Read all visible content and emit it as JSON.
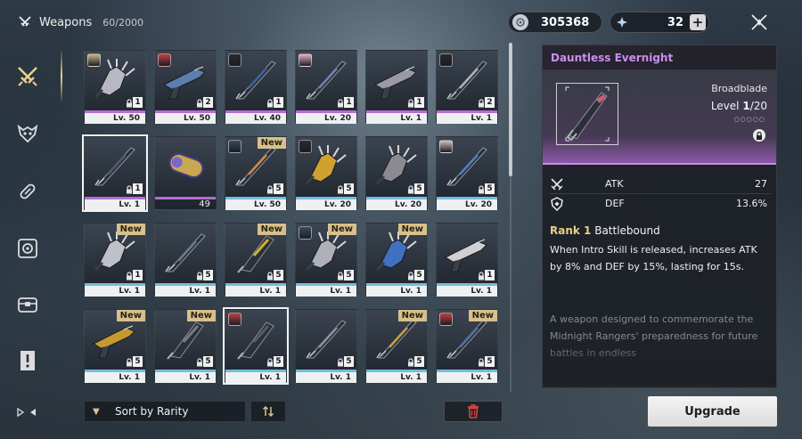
{
  "header": {
    "title": "Weapons",
    "count": "60/2000",
    "currency1": {
      "icon": "shell-credit-icon",
      "value": "305368"
    },
    "currency2": {
      "icon": "astrite-icon",
      "value": "32",
      "plus_label": "+"
    }
  },
  "sidebar": {
    "items": [
      {
        "name": "weapons",
        "icon": "crossed-swords-icon",
        "active": true
      },
      {
        "name": "echoes",
        "icon": "demon-head-icon",
        "active": false
      },
      {
        "name": "consumables",
        "icon": "capsule-icon",
        "active": false
      },
      {
        "name": "materials",
        "icon": "gear-emblem-icon",
        "active": false
      },
      {
        "name": "resources",
        "icon": "chest-icon",
        "active": false
      },
      {
        "name": "quest-items",
        "icon": "exclamation-doc-icon",
        "active": false
      }
    ],
    "bottom_icon": "play-control-icon"
  },
  "grid": {
    "items": [
      {
        "level": "Lv. 50",
        "rank": "1",
        "rarity": "purple",
        "locked": true,
        "avatar": "#c9b88a",
        "new": false,
        "color": "#b8b8c0",
        "kind": "gauntlet"
      },
      {
        "level": "Lv. 50",
        "rank": "2",
        "rarity": "purple",
        "locked": true,
        "avatar": "#c04040",
        "new": false,
        "color": "#5a7fb0",
        "kind": "pistol"
      },
      {
        "level": "Lv. 40",
        "rank": "1",
        "rarity": "purple",
        "locked": true,
        "avatar": "#2a2a30",
        "new": false,
        "color": "#3a5f9a",
        "kind": "sword"
      },
      {
        "level": "Lv. 20",
        "rank": "1",
        "rarity": "purple",
        "locked": true,
        "avatar": "#e8b0c8",
        "new": false,
        "color": "#6a80b8",
        "kind": "sword"
      },
      {
        "level": "Lv. 1",
        "rank": "1",
        "rarity": "purple",
        "locked": true,
        "avatar": "",
        "new": false,
        "color": "#9a9aa4",
        "kind": "pistol"
      },
      {
        "level": "Lv. 1",
        "rank": "2",
        "rarity": "purple",
        "locked": true,
        "avatar": "#2a2a30",
        "new": false,
        "color": "#b0b0b8",
        "kind": "sword"
      },
      {
        "level": "Lv. 1",
        "rank": "1",
        "rarity": "purple",
        "locked": true,
        "avatar": "",
        "new": false,
        "color": "#505868",
        "kind": "sword",
        "selected": true
      },
      {
        "quantity": "49",
        "rarity": "purple",
        "locked": false,
        "avatar": "",
        "new": false,
        "color": "#c8a850",
        "kind": "capsule"
      },
      {
        "level": "Lv. 50",
        "rank": "5",
        "rarity": "blue",
        "locked": true,
        "avatar": "#3a4a60",
        "new": true,
        "color": "#d08840",
        "kind": "sword"
      },
      {
        "level": "Lv. 20",
        "rank": "5",
        "rarity": "blue",
        "locked": true,
        "avatar": "#2a2a30",
        "new": false,
        "color": "#d0a030",
        "kind": "gauntlet"
      },
      {
        "level": "Lv. 20",
        "rank": "5",
        "rarity": "blue",
        "locked": true,
        "avatar": "",
        "new": false,
        "color": "#8a8a90",
        "kind": "gauntlet"
      },
      {
        "level": "Lv. 20",
        "rank": "5",
        "rarity": "blue",
        "locked": true,
        "avatar": "#d0c0c0",
        "new": false,
        "color": "#4a80c0",
        "kind": "sword"
      },
      {
        "level": "Lv. 1",
        "rank": "1",
        "rarity": "blue",
        "locked": true,
        "avatar": "",
        "new": true,
        "color": "#c0c0c8",
        "kind": "gauntlet"
      },
      {
        "level": "Lv. 1",
        "rank": "5",
        "rarity": "blue",
        "locked": true,
        "avatar": "",
        "new": false,
        "color": "#6a7a90",
        "kind": "sword"
      },
      {
        "level": "Lv. 1",
        "rank": "5",
        "rarity": "blue",
        "locked": true,
        "avatar": "",
        "new": true,
        "color": "#d0b030",
        "kind": "broad"
      },
      {
        "level": "Lv. 1",
        "rank": "5",
        "rarity": "blue",
        "locked": true,
        "avatar": "#3a4a60",
        "new": true,
        "color": "#b0b0b8",
        "kind": "gauntlet"
      },
      {
        "level": "Lv. 1",
        "rank": "5",
        "rarity": "blue",
        "locked": true,
        "avatar": "",
        "new": true,
        "color": "#4070c0",
        "kind": "gauntlet"
      },
      {
        "level": "Lv. 1",
        "rank": "1",
        "rarity": "blue",
        "locked": true,
        "avatar": "",
        "new": false,
        "color": "#d0d0d4",
        "kind": "pistol"
      },
      {
        "level": "Lv. 1",
        "rank": "5",
        "rarity": "blue",
        "locked": true,
        "avatar": "",
        "new": true,
        "color": "#c89830",
        "kind": "pistol"
      },
      {
        "level": "Lv. 1",
        "rank": "5",
        "rarity": "blue",
        "locked": true,
        "avatar": "",
        "new": true,
        "color": "#7a7a84",
        "kind": "broad"
      },
      {
        "level": "Lv. 1",
        "rank": "5",
        "rarity": "blue",
        "locked": true,
        "avatar": "#c04040",
        "new": false,
        "color": "#5a5a64",
        "kind": "broad",
        "selected": true
      },
      {
        "level": "Lv. 1",
        "rank": "5",
        "rarity": "blue",
        "locked": true,
        "avatar": "",
        "new": false,
        "color": "#909098",
        "kind": "sword"
      },
      {
        "level": "Lv. 1",
        "rank": "5",
        "rarity": "blue",
        "locked": true,
        "avatar": "",
        "new": true,
        "color": "#c8a040",
        "kind": "sword"
      },
      {
        "level": "Lv. 1",
        "rank": "5",
        "rarity": "blue",
        "locked": true,
        "avatar": "#c04040",
        "new": true,
        "color": "#5070a8",
        "kind": "sword"
      }
    ],
    "new_label": "New"
  },
  "controls": {
    "sort_label": "Sort by Rarity",
    "order_icon": "swap-order-icon",
    "delete_icon": "trash-icon"
  },
  "detail": {
    "name": "Dauntless Evernight",
    "type": "Broadblade",
    "level_label": "Level",
    "level_current": "1",
    "level_max": "/20",
    "rank_dots": "○○○○○",
    "stats": [
      {
        "name": "ATK",
        "value": "27",
        "icon": "atk-icon"
      },
      {
        "name": "DEF",
        "value": "13.6%",
        "icon": "def-icon"
      }
    ],
    "skill_rank": "Rank 1",
    "skill_name": "Battlebound",
    "skill_desc": "When Intro Skill is released, increases ATK by 8% and DEF by 15%, lasting for 15s.",
    "lore": "A weapon designed to commemorate the Midnight Rangers' preparedness for future battles in endless",
    "upgrade_label": "Upgrade"
  },
  "colors": {
    "accent_gold": "#e7cf87",
    "rarity_purple": "#b76bd6",
    "rarity_blue": "#72bde0",
    "name_purple": "#c88ff0"
  }
}
